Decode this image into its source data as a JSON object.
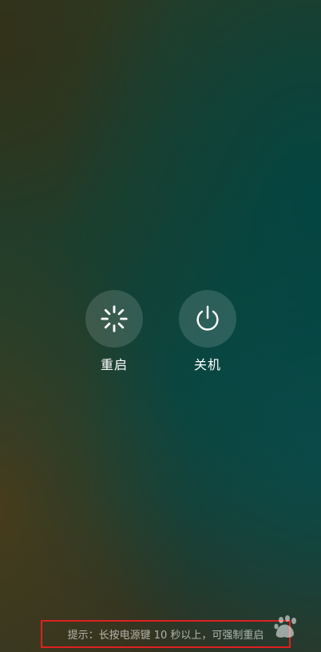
{
  "actions": {
    "restart": {
      "label": "重启",
      "icon": "restart-icon"
    },
    "power_off": {
      "label": "关机",
      "icon": "power-icon"
    }
  },
  "hint": {
    "text": "提示：长按电源键 10 秒以上，可强制重启"
  },
  "colors": {
    "button_fill": "rgba(255,255,255,0.14)",
    "label": "#ffffff",
    "hint_text": "rgba(255,255,255,0.62)",
    "annotation_box": "#e02020"
  },
  "watermark": {
    "icon": "baidu-jingyan-watermark"
  }
}
